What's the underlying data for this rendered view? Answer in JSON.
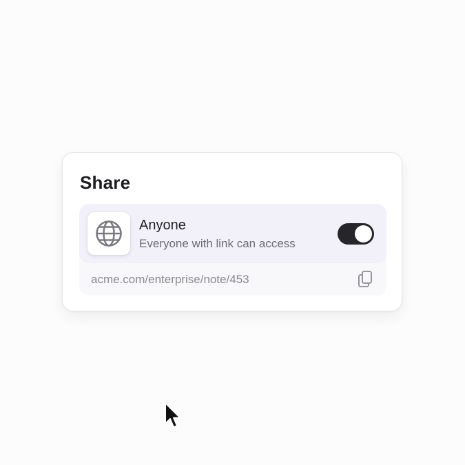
{
  "share_card": {
    "title": "Share",
    "access": {
      "icon": "globe-icon",
      "label": "Anyone",
      "description": "Everyone with link can access",
      "enabled": true
    },
    "link": {
      "url": "acme.com/enterprise/note/453",
      "copy_icon": "copy-icon"
    }
  },
  "colors": {
    "toggle_on": "#26262a",
    "access_row_bg": "#f2f1f9",
    "text_primary": "#1e1e22",
    "text_secondary": "#6c6c72"
  }
}
